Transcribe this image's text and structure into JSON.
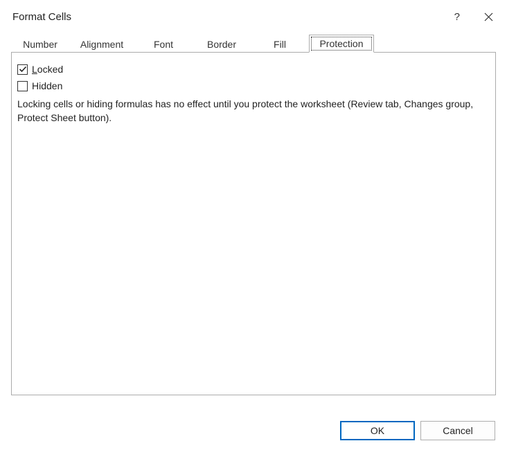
{
  "title": "Format Cells",
  "help_symbol": "?",
  "tabs": {
    "number": "Number",
    "alignment": "Alignment",
    "font": "Font",
    "border": "Border",
    "fill": "Fill",
    "protection": "Protection"
  },
  "protection": {
    "locked_mnemonic": "L",
    "locked_rest": "ocked",
    "hidden_mnemonic": "H",
    "hidden_rest": "idden",
    "info": "Locking cells or hiding formulas has no effect until you protect the worksheet (Review tab, Changes group, Protect Sheet button)."
  },
  "buttons": {
    "ok": "OK",
    "cancel": "Cancel"
  }
}
